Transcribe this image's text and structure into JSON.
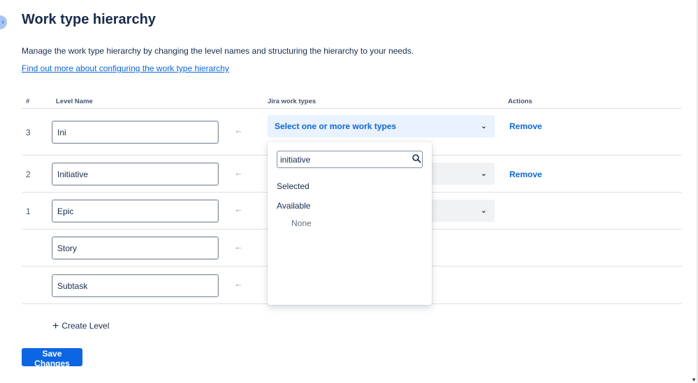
{
  "sidebar": {
    "collapse_icon": "chevron-left-icon",
    "collapse_glyph": "‹"
  },
  "page": {
    "title": "Work type hierarchy",
    "description": "Manage the work type hierarchy by changing the level names and structuring the hierarchy to your needs.",
    "learn_more_link": "Find out more about configuring the work type hierarchy"
  },
  "table": {
    "headers": {
      "number": "#",
      "level_name": "Level Name",
      "work_types": "Jira work types",
      "actions": "Actions"
    },
    "rows": [
      {
        "number": "3",
        "level_name": "Ini",
        "work_types_text": "Select one or more work types",
        "action": "Remove"
      },
      {
        "number": "2",
        "level_name": "Initiative",
        "work_types_text": "",
        "action": "Remove"
      },
      {
        "number": "1",
        "level_name": "Epic",
        "work_types_text": "",
        "action": ""
      },
      {
        "number": "",
        "level_name": "Story",
        "work_types_text": "",
        "action": ""
      },
      {
        "number": "",
        "level_name": "Subtask",
        "work_types_text": "",
        "action": ""
      }
    ],
    "arrow_glyph": "←",
    "chevron_glyph": "⌄"
  },
  "dropdown": {
    "search_value": "initiative",
    "search_icon": "search-icon",
    "selected_label": "Selected",
    "available_label": "Available",
    "none_label": "None"
  },
  "actions": {
    "create_level_label": "Create Level",
    "create_level_icon": "+",
    "save_label": "Save Changes"
  },
  "colors": {
    "accent": "#0c66e4",
    "text": "#172b4d",
    "select_active_bg": "#e9f2ff",
    "select_bg": "#f1f2f4"
  }
}
